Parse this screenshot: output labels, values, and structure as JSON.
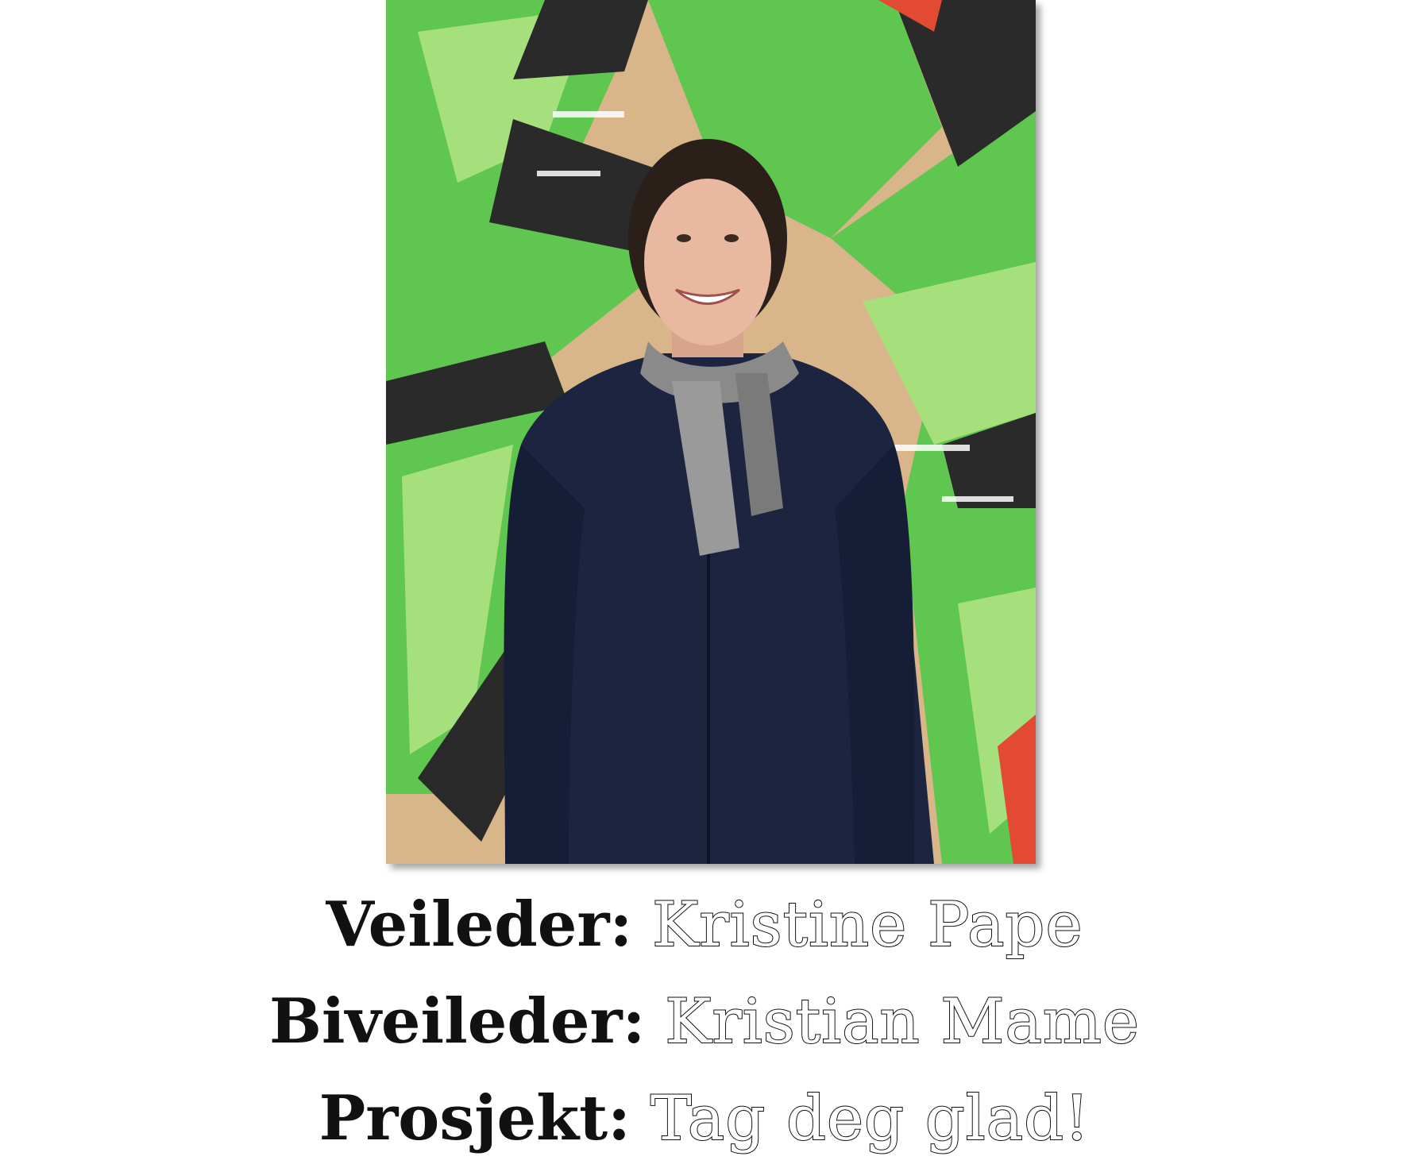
{
  "photo": {
    "icon": "person-portrait-photo",
    "colors": {
      "graffiti_green": "#5fc64f",
      "graffiti_light_green": "#a6e07c",
      "graffiti_dark": "#2a2a2a",
      "wall_beige": "#d9b58a",
      "jacket_navy": "#1c2440",
      "skin": "#e8b9a0",
      "hair": "#2b1f1a",
      "scarf_grey": "#8a8a8a",
      "accent_red": "#e24a33"
    }
  },
  "lines": [
    {
      "label": "Veileder:",
      "value": "Kristine Pape"
    },
    {
      "label": "Biveileder:",
      "value": "Kristian Mame"
    },
    {
      "label": "Prosjekt:",
      "value": "Tag deg glad!"
    }
  ]
}
